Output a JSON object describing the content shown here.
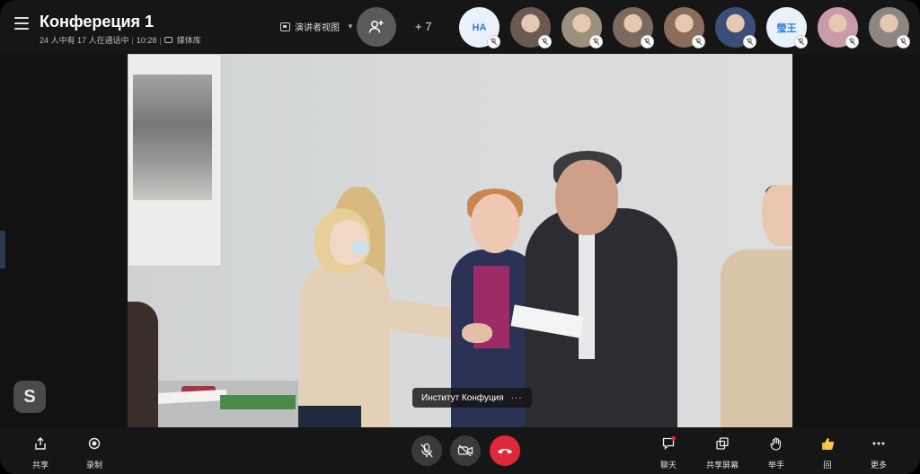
{
  "header": {
    "title": "Конфереция 1",
    "in_call": "24 人中有 17 人在通话中",
    "time": "10:28",
    "media_label": "媒体库",
    "view_mode": "演讲者视图",
    "more_participants": "+ 7"
  },
  "participants": [
    {
      "initials": "HA",
      "kind": "initials"
    },
    {
      "initials": "",
      "kind": "photo",
      "color": "#6b5a52"
    },
    {
      "initials": "",
      "kind": "photo",
      "color": "#9c8f7c"
    },
    {
      "initials": "",
      "kind": "photo",
      "color": "#7a6a5e"
    },
    {
      "initials": "",
      "kind": "photo",
      "color": "#8a6d5a"
    },
    {
      "initials": "",
      "kind": "photo",
      "color": "#3b4e7a"
    },
    {
      "initials": "瑩王",
      "kind": "initials"
    },
    {
      "initials": "",
      "kind": "photo",
      "color": "#c99aa8"
    },
    {
      "initials": "",
      "kind": "photo",
      "color": "#8d8680"
    }
  ],
  "video": {
    "speaker_name": "Институт Конфуция",
    "more_label": "···"
  },
  "toolbar": {
    "share_label": "共享",
    "record_label": "录制",
    "chat_label": "聊天",
    "screen_share_label": "共享屏幕",
    "raise_hand_label": "举手",
    "react_label": "回",
    "more_label": "更多"
  },
  "colors": {
    "end_call": "#e0283a",
    "accent_blue": "#2a7de1",
    "bar_bg": "#161616"
  }
}
